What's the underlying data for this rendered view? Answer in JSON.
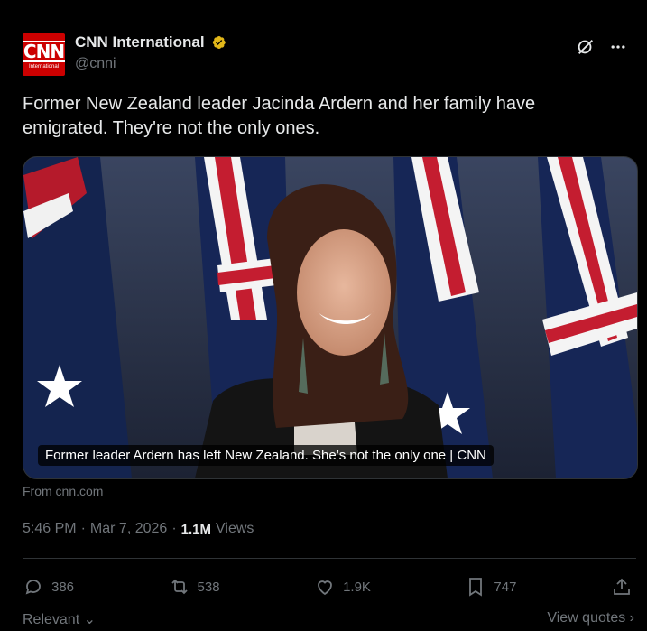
{
  "header": {
    "avatar_text": "CNN",
    "avatar_sub": "International",
    "display_name": "CNN International",
    "handle": "@cnni",
    "verified_icon": "gold-verified-badge-icon",
    "grok_icon": "grok-icon",
    "more_icon": "more-dots-icon"
  },
  "tweet": {
    "text": "Former New Zealand leader Jacinda Ardern and her family have emigrated. They're not the only ones."
  },
  "media": {
    "caption": "Former leader Ardern has left New Zealand. She’s not the only one | CNN",
    "from": "From cnn.com"
  },
  "meta": {
    "time": "5:46 PM",
    "date": "Mar 7, 2026",
    "sep": "·",
    "views_count": "1.1M",
    "views_label": "Views"
  },
  "actions": {
    "replies": "386",
    "reposts": "538",
    "likes": "1.9K",
    "bookmarks": "747"
  },
  "footer": {
    "relevant": "Relevant",
    "view_quotes": "View quotes"
  },
  "colors": {
    "background": "#000000",
    "text": "#e7e9ea",
    "muted": "#71767b",
    "border": "#2f3336",
    "cnn_red": "#cc0000",
    "verified_gold": "#e2b719"
  }
}
